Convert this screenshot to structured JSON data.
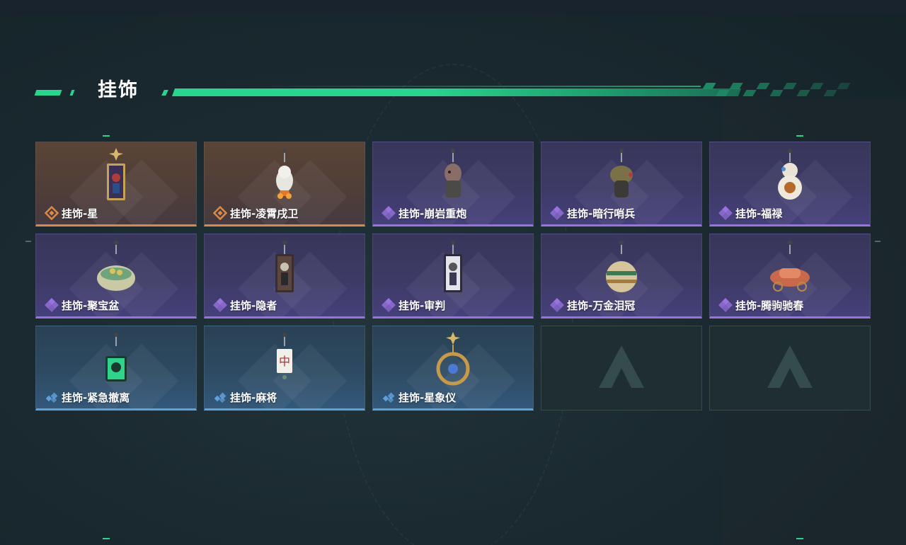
{
  "section": {
    "title": "挂饰"
  },
  "colors": {
    "accent": "#2ad48e",
    "rarity_orange": "#d98a48",
    "rarity_purple": "#9a72e0",
    "rarity_blue": "#5fa1dc"
  },
  "items": [
    {
      "label": "挂饰-星",
      "rarity": "orange",
      "icon": "star-tarot-charm-icon"
    },
    {
      "label": "挂饰-凌霄戌卫",
      "rarity": "orange",
      "icon": "dog-guard-charm-icon"
    },
    {
      "label": "挂饰-崩岩重炮",
      "rarity": "purple",
      "icon": "rock-cannon-charm-icon"
    },
    {
      "label": "挂饰-暗行哨兵",
      "rarity": "purple",
      "icon": "sentinel-charm-icon"
    },
    {
      "label": "挂饰-福禄",
      "rarity": "purple",
      "icon": "gourd-robot-charm-icon"
    },
    {
      "label": "挂饰-聚宝盆",
      "rarity": "purple",
      "icon": "treasure-bowl-charm-icon"
    },
    {
      "label": "挂饰-隐者",
      "rarity": "purple",
      "icon": "hermit-tarot-charm-icon"
    },
    {
      "label": "挂饰-审判",
      "rarity": "purple",
      "icon": "judgement-tarot-charm-icon"
    },
    {
      "label": "挂饰-万金泪冠",
      "rarity": "purple",
      "icon": "golden-crown-charm-icon"
    },
    {
      "label": "挂饰-腾驹驰春",
      "rarity": "purple",
      "icon": "carriage-charm-icon"
    },
    {
      "label": "挂饰-紧急撤离",
      "rarity": "blue",
      "icon": "emergency-exit-charm-icon"
    },
    {
      "label": "挂饰-麻将",
      "rarity": "blue",
      "icon": "mahjong-tile-charm-icon"
    },
    {
      "label": "挂饰-星象仪",
      "rarity": "blue",
      "icon": "astrolabe-charm-icon"
    }
  ],
  "empty_slots": 2
}
